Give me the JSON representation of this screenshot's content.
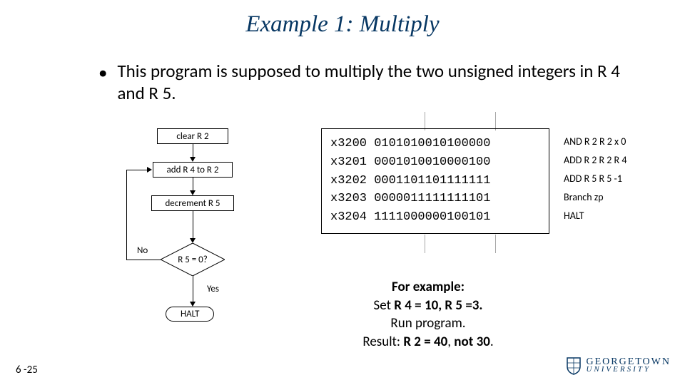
{
  "title": "Example 1: Multiply",
  "bullet": "This program is supposed to multiply the two unsigned integers in R 4 and R 5.",
  "flow": {
    "clear": "clear R 2",
    "add": "add R 4 to R 2",
    "dec": "decrement R 5",
    "cond": "R 5 = 0?",
    "no": "No",
    "yes": "Yes",
    "halt": "HALT"
  },
  "code": [
    {
      "addr": "x3200",
      "bits": "0101010010100000",
      "annot": "AND R 2 R 2 x 0"
    },
    {
      "addr": "x3201",
      "bits": "0001010010000100",
      "annot": "ADD R 2 R 2 R 4"
    },
    {
      "addr": "x3202",
      "bits": "0001101101111111",
      "annot": "ADD R 5 R 5 -1"
    },
    {
      "addr": "x3203",
      "bits": "0000011111111101",
      "annot": "Branch zp"
    },
    {
      "addr": "x3204",
      "bits": "1111000000100101",
      "annot": "HALT"
    }
  ],
  "hint": {
    "l1": "For example:",
    "l2a": "Set ",
    "l2b": "R 4 = 10, R 5 =3.",
    "l3": "Run program.",
    "l4a": "Result: ",
    "l4b": "R 2 = 40",
    "l4c": ", ",
    "l4d": "not 30",
    "l4e": "."
  },
  "footer": "6 -25",
  "logo": {
    "main": "GEORGETOWN",
    "sub": "UNIVERSITY"
  }
}
